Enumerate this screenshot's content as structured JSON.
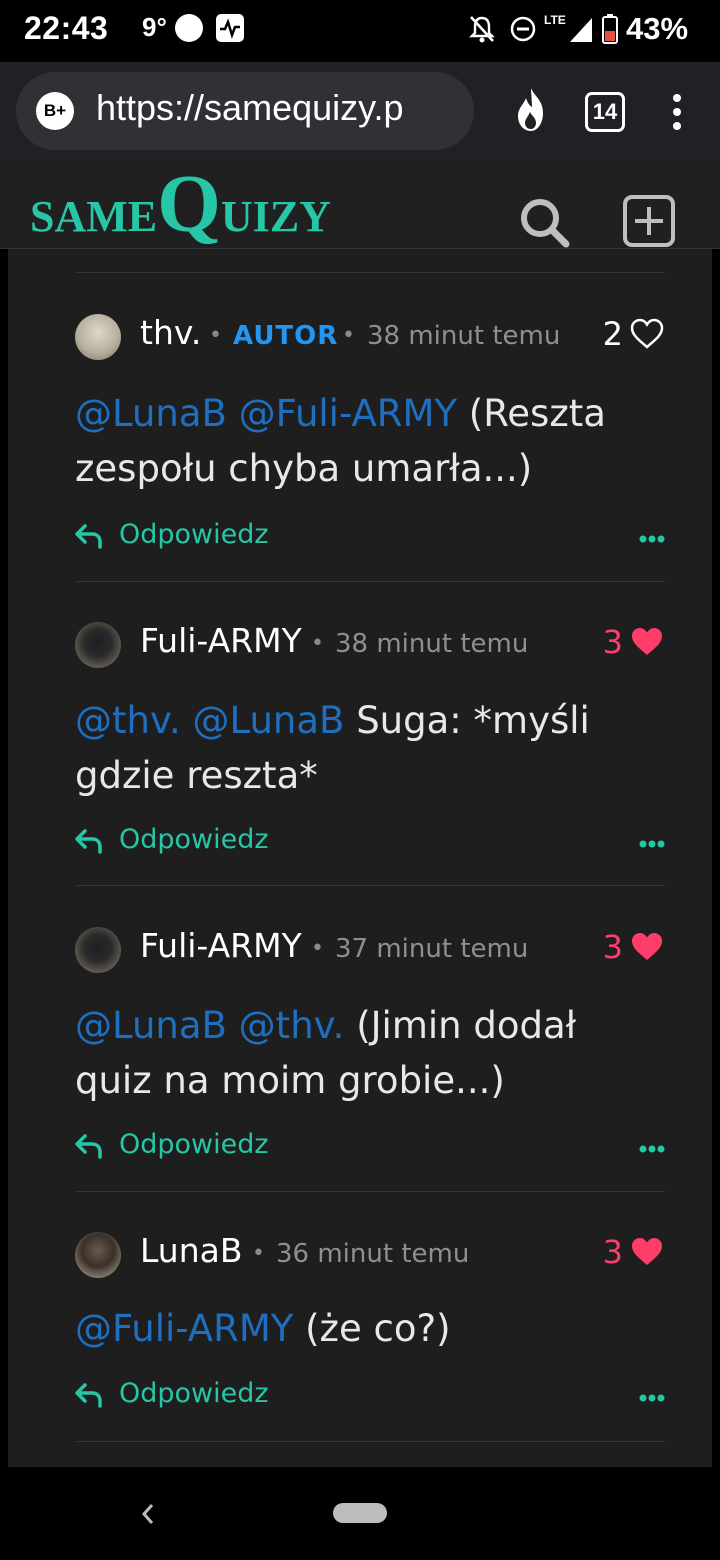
{
  "status_bar": {
    "time": "22:43",
    "temperature": "9°",
    "network": "LTE",
    "battery": "43%"
  },
  "browser": {
    "url": "https://samequizy.p",
    "tab_count": "14",
    "site_badge": "B+"
  },
  "site": {
    "logo_same": "SAME",
    "logo_q": "Q",
    "logo_uizy": "UIZY",
    "accent_color": "#26c6a6"
  },
  "comments": [
    {
      "user": "thv.",
      "badge": "AUTOR",
      "dot": "•",
      "time": "38 minut temu",
      "likes": "2",
      "liked": false,
      "mentions": "@LunaB @Fuli-ARMY",
      "text": " (Reszta zespołu chyba umarła...)",
      "reply_label": "Odpowiedz"
    },
    {
      "user": "Fuli-ARMY",
      "dot": "•",
      "time": "38 minut temu",
      "likes": "3",
      "liked": true,
      "mentions": "@thv. @LunaB",
      "text": " Suga: *myśli gdzie reszta*",
      "reply_label": "Odpowiedz"
    },
    {
      "user": "Fuli-ARMY",
      "dot": "•",
      "time": "37 minut temu",
      "likes": "3",
      "liked": true,
      "mentions": "@LunaB @thv.",
      "text": " (Jimin dodał quiz na moim grobie...)",
      "reply_label": "Odpowiedz"
    },
    {
      "user": "LunaB",
      "dot": "•",
      "time": "36 minut temu",
      "likes": "3",
      "liked": true,
      "mentions": "@Fuli-ARMY",
      "text": " (że co?)",
      "reply_label": "Odpowiedz"
    }
  ],
  "colors": {
    "like_active": "#ff3d6a",
    "mention": "#1e6fbf",
    "autor_badge": "#2196f3"
  }
}
